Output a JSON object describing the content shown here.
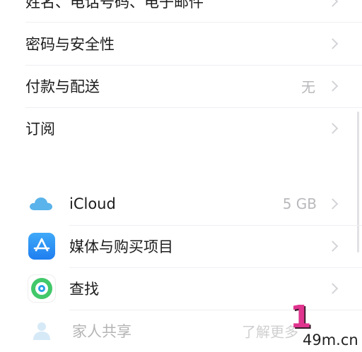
{
  "rows": {
    "name": {
      "label": "姓名、电话号码、电子邮件"
    },
    "password": {
      "label": "密码与安全性"
    },
    "payment": {
      "label": "付款与配送",
      "value": "无"
    },
    "subscriptions": {
      "label": "订阅"
    },
    "icloud": {
      "label": "iCloud",
      "value": "5 GB",
      "icon": "icloud-icon"
    },
    "media": {
      "label": "媒体与购买项目",
      "icon": "app-store-icon"
    },
    "find": {
      "label": "查找",
      "icon": "find-my-icon"
    },
    "family": {
      "label": "家人共享",
      "value": "了解更多",
      "icon": "family-sharing-icon"
    }
  },
  "watermark": {
    "digit": "1",
    "text": "49m.cn"
  },
  "colors": {
    "accent_appstore": "#2b8cf5",
    "find_green": "#34c759",
    "icloud_blue": "#5ab3ea",
    "watermark_pink": "#e0348e"
  }
}
